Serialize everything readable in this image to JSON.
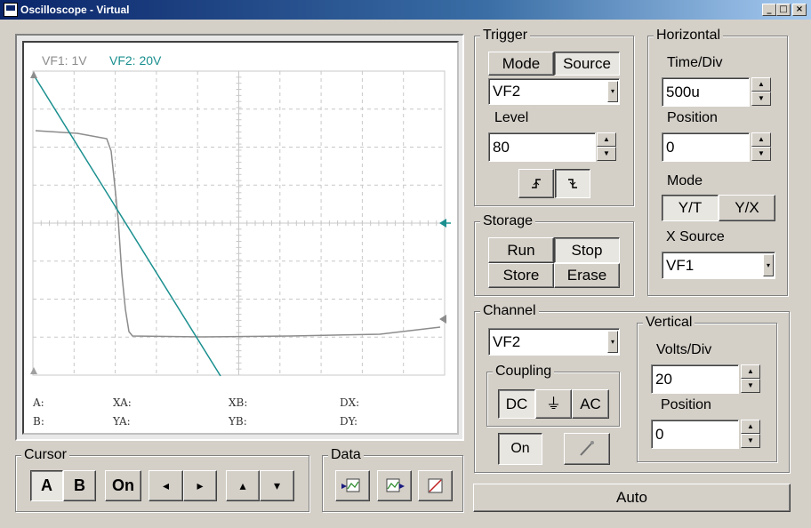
{
  "window": {
    "title": "Oscilloscope - Virtual",
    "min": "_",
    "max": "□",
    "close": "×"
  },
  "screen": {
    "ch1_label": "VF1: 1V",
    "ch2_label": "VF2: 20V",
    "ch1_color": "#8c8c8c",
    "ch2_color": "#1b8f8f",
    "measurements": {
      "a": "A:",
      "b": "B:",
      "xa": "XA:",
      "ya": "YA:",
      "xb": "XB:",
      "yb": "YB:",
      "dx": "DX:",
      "dy": "DY:"
    }
  },
  "trigger": {
    "title": "Trigger",
    "mode_label": "Mode",
    "source_label": "Source",
    "source_value": "VF2",
    "level_label": "Level",
    "level_value": "80",
    "rising_icon": "rising-edge-icon",
    "falling_icon": "falling-edge-icon"
  },
  "horizontal": {
    "title": "Horizontal",
    "time_div_label": "Time/Div",
    "time_div_value": "500u",
    "position_label": "Position",
    "position_value": "0",
    "mode_label": "Mode",
    "yt_label": "Y/T",
    "yx_label": "Y/X",
    "xsource_label": "X Source",
    "xsource_value": "VF1"
  },
  "storage": {
    "title": "Storage",
    "run": "Run",
    "stop": "Stop",
    "store": "Store",
    "erase": "Erase"
  },
  "channel": {
    "title": "Channel",
    "value": "VF2",
    "coupling_title": "Coupling",
    "dc": "DC",
    "gnd": "⏚",
    "ac": "AC",
    "on": "On"
  },
  "vertical": {
    "title": "Vertical",
    "volts_div_label": "Volts/Div",
    "volts_div_value": "20",
    "position_label": "Position",
    "position_value": "0"
  },
  "cursor": {
    "title": "Cursor",
    "a": "A",
    "b": "B",
    "on": "On",
    "left": "◂",
    "right": "▸",
    "up": "▴",
    "down": "▾"
  },
  "data": {
    "title": "Data"
  },
  "auto": "Auto"
}
